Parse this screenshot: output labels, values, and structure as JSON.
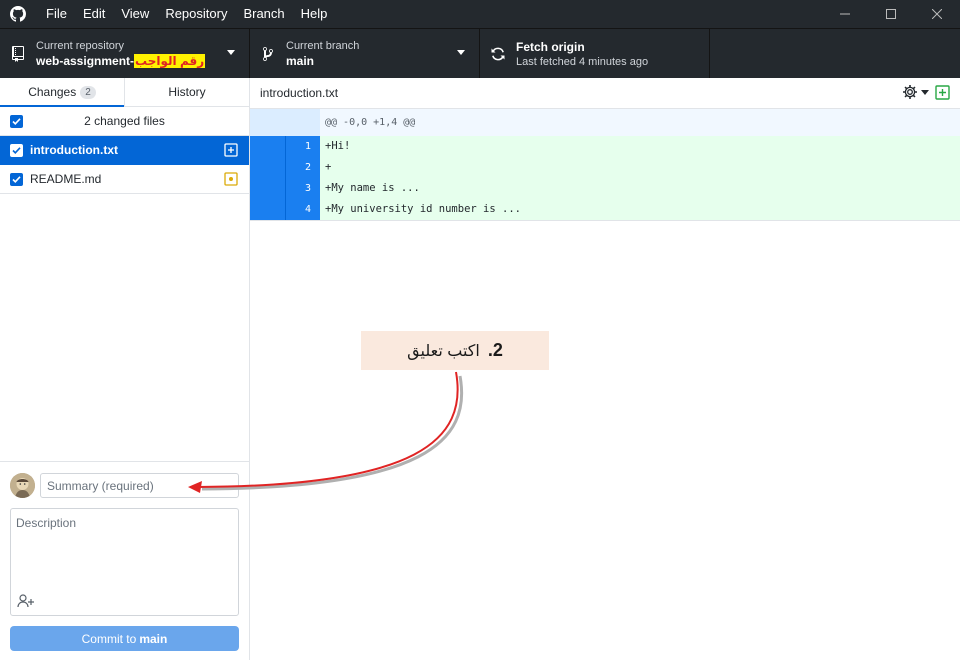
{
  "menu": [
    "File",
    "Edit",
    "View",
    "Repository",
    "Branch",
    "Help"
  ],
  "toolbar": {
    "repo_label": "Current repository",
    "repo_name_prefix": "web-assignment-",
    "repo_name_highlight": "رقم الواجب",
    "branch_label": "Current branch",
    "branch_name": "main",
    "fetch_title": "Fetch origin",
    "fetch_status": "Last fetched 4 minutes ago"
  },
  "tabs": {
    "changes_label": "Changes",
    "changes_count": "2",
    "history_label": "History"
  },
  "changes": {
    "header": "2 changed files",
    "files": [
      {
        "name": "introduction.txt",
        "status": "added"
      },
      {
        "name": "README.md",
        "status": "modified"
      }
    ]
  },
  "commit": {
    "summary_placeholder": "Summary (required)",
    "description_placeholder": "Description",
    "button_prefix": "Commit to",
    "button_branch": "main"
  },
  "diff": {
    "path": "introduction.txt",
    "hunk_header": "@@ -0,0 +1,4 @@",
    "lines": [
      {
        "num": "1",
        "text": "+Hi!"
      },
      {
        "num": "2",
        "text": "+"
      },
      {
        "num": "3",
        "text": "+My name is ..."
      },
      {
        "num": "4",
        "text": "+My university id number is ..."
      }
    ]
  },
  "annotation": {
    "step": "2.",
    "text": "اكتب تعليق"
  },
  "colors": {
    "accent": "#0366d6",
    "titlebar": "#24292e",
    "diff_added_bg": "#e6ffed",
    "added_icon": "#28a745",
    "modified_icon": "#dbab09",
    "annotation_bg": "#fae9de",
    "arrow": "#e02424"
  }
}
